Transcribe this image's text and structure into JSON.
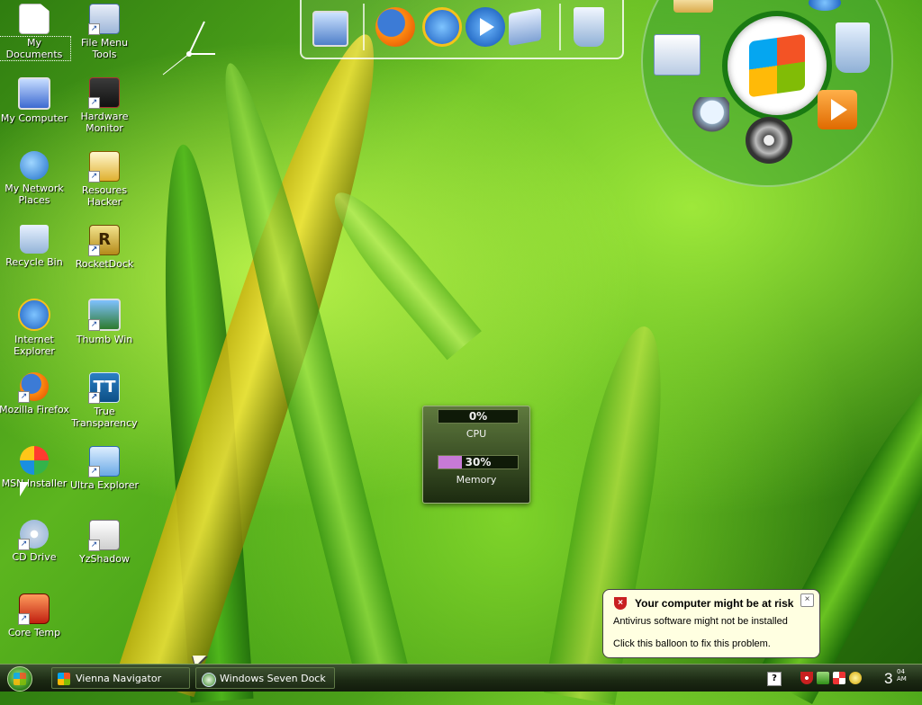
{
  "desktop": {
    "icons": [
      {
        "label": "My Documents"
      },
      {
        "label": "File Menu Tools"
      },
      {
        "label": "My Computer"
      },
      {
        "label": "Hardware Monitor"
      },
      {
        "label": "My Network Places"
      },
      {
        "label": "Resoures Hacker"
      },
      {
        "label": "Recycle Bin"
      },
      {
        "label": "RocketDock"
      },
      {
        "label": "Internet Explorer"
      },
      {
        "label": "Thumb Win"
      },
      {
        "label": "Mozilla Firefox"
      },
      {
        "label": "True Transparency"
      },
      {
        "label": "MSN Installer"
      },
      {
        "label": "Ultra Explorer"
      },
      {
        "label": "CD Drive"
      },
      {
        "label": "YzShadow"
      },
      {
        "label": "Core Temp"
      }
    ],
    "rocketdock_letter": "R",
    "true_transparency_letters": "TT"
  },
  "gadget": {
    "cpu_percent": "0%",
    "cpu_value": 0,
    "cpu_label": "CPU",
    "memory_percent": "30%",
    "memory_value": 30,
    "memory_label": "Memory"
  },
  "balloon": {
    "title": "Your computer might be at risk",
    "line1": "Antivirus software might not be installed",
    "line2": "Click this balloon to fix this problem.",
    "close": "×"
  },
  "taskbar": {
    "buttons": [
      {
        "label": "Vienna Navigator"
      },
      {
        "label": "Windows Seven Dock"
      }
    ],
    "clock_time": "3",
    "clock_minutes": "04",
    "clock_ampm": "AM",
    "help_glyph": "?"
  },
  "colors": {
    "accent_green": "#1a7a12",
    "cpu_bar": "#3e7a2c",
    "memory_bar": "#c77ad6",
    "balloon_bg": "#ffffe1",
    "risk_red": "#c82020"
  }
}
